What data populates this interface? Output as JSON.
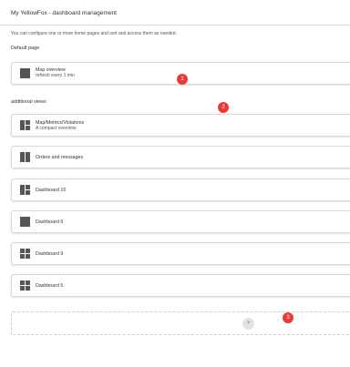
{
  "header": {
    "title": "My YellowFox - dashboard management"
  },
  "intro_text": "You can configure one or more home pages and sort and access them as needed.",
  "default_section": {
    "label": "Default page",
    "card": {
      "name": "Map overview",
      "sub": "refresh every 1 min"
    }
  },
  "additional_section": {
    "label": "additional views",
    "cards": [
      {
        "name": "Map/Metrics/Violations",
        "sub": "A compact overview",
        "icon": "layout-3-icon"
      },
      {
        "name": "Orders and messages",
        "sub": "",
        "icon": "layout-2-columns-icon"
      },
      {
        "name": "Dashboard 10",
        "sub": "",
        "icon": "layout-3-right-icon"
      },
      {
        "name": "Dashboard 6",
        "sub": "",
        "icon": "layout-single-icon"
      },
      {
        "name": "Dashboard 9",
        "sub": "",
        "icon": "layout-4-icon"
      },
      {
        "name": "Dashboard 5",
        "sub": "",
        "icon": "layout-4-icon"
      }
    ]
  },
  "add_button": {
    "symbol": "+"
  },
  "markers": [
    "1",
    "2",
    "3"
  ],
  "colors": {
    "marker": "#e83a36",
    "icon": "#555555",
    "border": "#d9d9d9"
  }
}
